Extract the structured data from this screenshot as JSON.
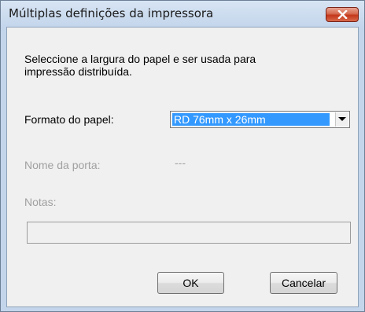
{
  "window": {
    "title": "Múltiplas definições da impressora"
  },
  "dialog": {
    "instruction_line1": "Seleccione a largura do papel e ser usada para",
    "instruction_line2": "impressão distribuída.",
    "paper_format_label": "Formato do papel:",
    "paper_format_value": "RD 76mm x 26mm",
    "port_name_label": "Nome da porta:",
    "port_name_value": "---",
    "notes_label": "Notas:",
    "notes_value": ""
  },
  "buttons": {
    "ok_label": "OK",
    "cancel_label": "Cancelar"
  },
  "colors": {
    "selection": "#3399ff",
    "disabled_text": "#a0a0a0",
    "title_bar": "#c4d6ec",
    "close_button": "#c4371b"
  },
  "icons": {
    "close": "close-icon",
    "dropdown": "chevron-down-icon"
  }
}
